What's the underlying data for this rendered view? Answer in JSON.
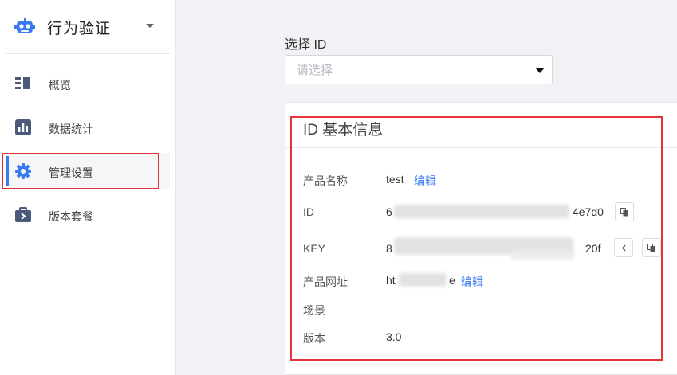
{
  "sidebar": {
    "brand_title": "行为验证",
    "items": [
      {
        "label": "概览"
      },
      {
        "label": "数据统计"
      },
      {
        "label": "管理设置"
      },
      {
        "label": "版本套餐"
      }
    ]
  },
  "main": {
    "select_label": "选择 ID",
    "select_placeholder": "请选择",
    "card": {
      "title": "ID 基本信息",
      "rows": {
        "name_label": "产品名称",
        "name_value": "test",
        "name_edit": "编辑",
        "id_label": "ID",
        "id_start": "6",
        "id_end": "4e7d0",
        "key_label": "KEY",
        "key_start": "8",
        "key_end": "20f",
        "url_label": "产品网址",
        "url_start": "ht",
        "url_end": "e",
        "url_edit": "编辑",
        "scene_label": "场景",
        "version_label": "版本",
        "version_value": "3.0"
      }
    }
  },
  "colors": {
    "accent": "#3a7bf4",
    "highlight": "#e6333a",
    "sidebar_icon": "#4a5a78"
  }
}
